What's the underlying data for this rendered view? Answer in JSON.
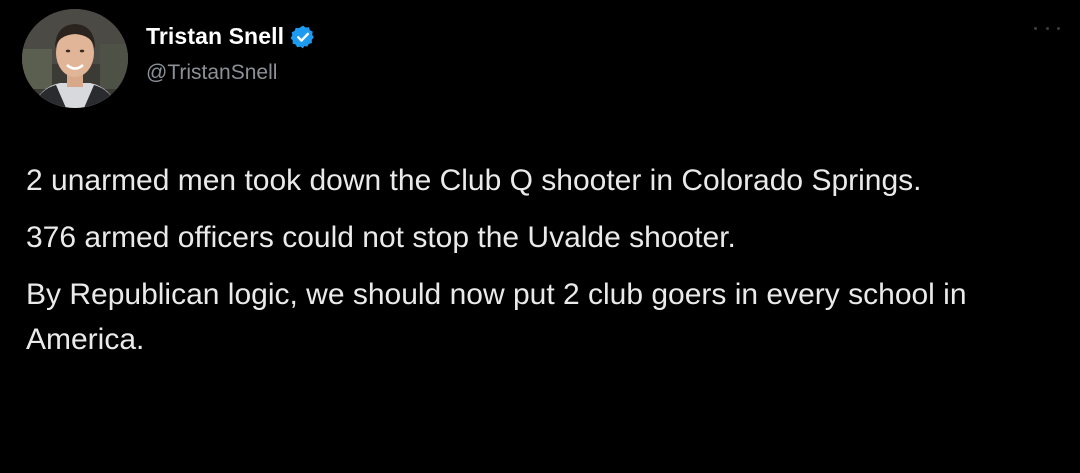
{
  "author": {
    "display_name": "Tristan Snell",
    "handle": "@TristanSnell",
    "verified": true,
    "avatar_icon": "profile-photo-icon"
  },
  "tweet": {
    "paragraphs": [
      "2 unarmed men took down the Club Q shooter in Colorado Springs.",
      "376 armed officers could not stop the Uvalde shooter.",
      "By Republican logic, we should now put 2 club goers in every school in America."
    ]
  },
  "icons": {
    "verified": "verified-badge-icon",
    "more": "more-options-icon"
  },
  "colors": {
    "background": "#000000",
    "name": "#ffffff",
    "handle": "#8b9196",
    "text": "#eaeaea",
    "verified": "#1d9bf0"
  }
}
